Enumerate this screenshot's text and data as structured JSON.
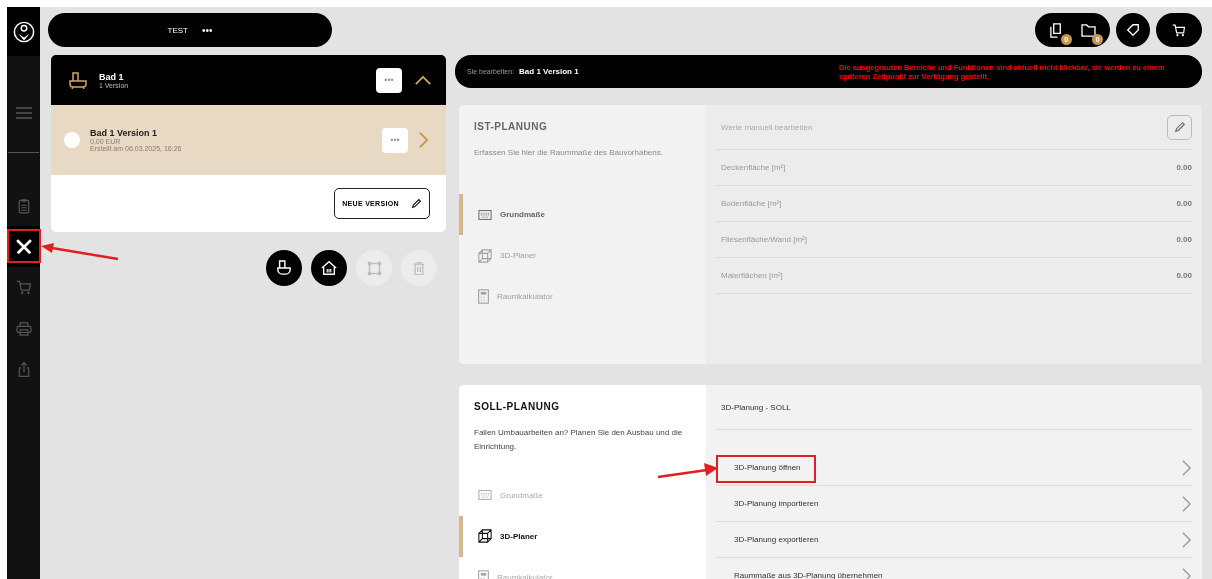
{
  "sidebar": {
    "items": [
      {
        "selected": false
      },
      {
        "selected": false
      },
      {
        "selected": true
      },
      {
        "selected": false
      },
      {
        "selected": false
      },
      {
        "selected": false
      }
    ]
  },
  "project": {
    "name": "TEST",
    "menu": "•••"
  },
  "header_actions": {
    "badges": [
      "0",
      "0"
    ]
  },
  "room": {
    "title": "Bad 1",
    "subtitle": "1 Version",
    "expanded": true,
    "menu": "•••",
    "versions": [
      {
        "name": "Bad 1 Version 1",
        "price": "0,00 EUR",
        "created": "Erstellt am 06.03.2025, 16:26",
        "selected": false,
        "menu": "•••"
      }
    ],
    "new_version_button": "NEUE VERSION"
  },
  "room_actions": [
    {
      "disabled": false
    },
    {
      "disabled": false
    },
    {
      "disabled": true
    },
    {
      "disabled": true
    }
  ],
  "edit_bar": {
    "label": "Sie bearbeiten:",
    "value": "Bad 1 Version 1",
    "notice": "Die ausgegrauten Bereiche und Funktionen sind aktuell nicht klickbar, sie werden zu einem späteren Zeitpunkt zur Verfügung gestellt."
  },
  "sections": [
    {
      "kind": "values",
      "title": "IST-PLANUNG",
      "description": "Erfassen Sie hier die Raummaße des Bauvorhabens.",
      "disabled": true,
      "nav": [
        {
          "label": "Grundmaße",
          "selected": true,
          "disabled": false
        },
        {
          "label": "3D-Planer",
          "selected": false,
          "disabled": true
        },
        {
          "label": "Raumkalkulator",
          "selected": false,
          "disabled": true
        }
      ],
      "panel_title": "Werte manuell bearbeiten",
      "rows": [
        {
          "label": "Deckenfläche [m²]",
          "value": "0.00"
        },
        {
          "label": "Bodenfläche [m²]",
          "value": "0.00"
        },
        {
          "label": "Fliesenfläche/Wand [m²]",
          "value": "0.00"
        },
        {
          "label": "Malerflächen [m²]",
          "value": "0.00"
        }
      ]
    },
    {
      "kind": "actions",
      "title": "SOLL-PLANUNG",
      "description": "Fallen Umbauarbeiten an? Planen Sie den Ausbau und die Einrichtung.",
      "disabled": false,
      "nav": [
        {
          "label": "Grundmaße",
          "selected": false,
          "disabled": true
        },
        {
          "label": "3D-Planer",
          "selected": true,
          "disabled": false
        },
        {
          "label": "Raumkalkulator",
          "selected": false,
          "disabled": true
        }
      ],
      "panel_title": "3D-Planung - SOLL",
      "rows": [
        {
          "label": "3D-Planung öffnen"
        },
        {
          "label": "3D-Planung importieren"
        },
        {
          "label": "3D-Planung exportieren"
        },
        {
          "label": "Raummaße aus 3D-Planung übernehmen"
        }
      ]
    }
  ]
}
